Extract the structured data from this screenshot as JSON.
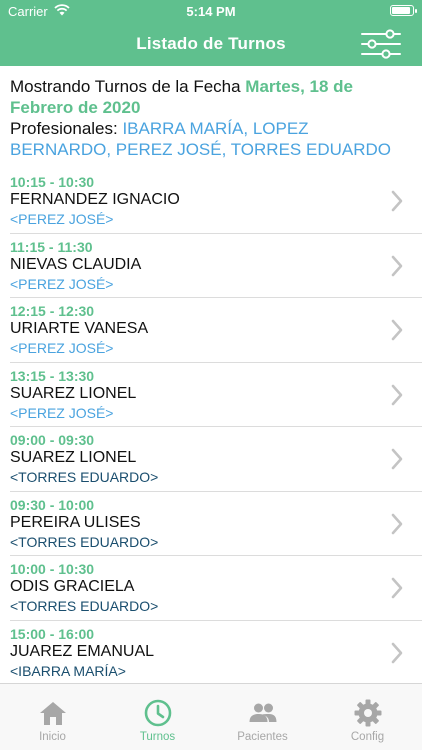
{
  "status_bar": {
    "carrier": "Carrier",
    "time": "5:14 PM"
  },
  "nav": {
    "title": "Listado de Turnos",
    "filter_icon": "sliders-icon"
  },
  "header": {
    "prefix": "Mostrando Turnos de la Fecha ",
    "date": "Martes, 18 de Febrero de 2020",
    "prof_prefix": "Profesionales: ",
    "professionals": "IBARRA MARÍA, LOPEZ BERNARDO, PEREZ JOSÉ, TORRES EDUARDO"
  },
  "appointments": [
    {
      "time": "10:15 - 10:30",
      "patient": "FERNANDEZ IGNACIO",
      "professional": "<PEREZ JOSÉ>"
    },
    {
      "time": "11:15 - 11:30",
      "patient": "NIEVAS CLAUDIA",
      "professional": "<PEREZ JOSÉ>"
    },
    {
      "time": "12:15 - 12:30",
      "patient": "URIARTE VANESA",
      "professional": "<PEREZ JOSÉ>"
    },
    {
      "time": "13:15 - 13:30",
      "patient": "SUAREZ LIONEL",
      "professional": "<PEREZ JOSÉ>"
    },
    {
      "time": "09:00 - 09:30",
      "patient": "SUAREZ LIONEL",
      "professional": "<TORRES EDUARDO>"
    },
    {
      "time": "09:30 - 10:00",
      "patient": "PEREIRA ULISES",
      "professional": "<TORRES EDUARDO>"
    },
    {
      "time": "10:00 - 10:30",
      "patient": "ODIS GRACIELA",
      "professional": "<TORRES EDUARDO>"
    },
    {
      "time": "15:00 - 16:00",
      "patient": "JUAREZ EMANUAL",
      "professional": "<IBARRA MARÍA>"
    }
  ],
  "tabs": [
    {
      "label": "Inicio",
      "icon": "home-icon",
      "active": false
    },
    {
      "label": "Turnos",
      "icon": "clock-icon",
      "active": true
    },
    {
      "label": "Pacientes",
      "icon": "people-icon",
      "active": false
    },
    {
      "label": "Config",
      "icon": "gear-icon",
      "active": false
    }
  ],
  "colors": {
    "brand": "#5fc08e",
    "link": "#4aa3df",
    "inactive": "#a7a7a7"
  }
}
